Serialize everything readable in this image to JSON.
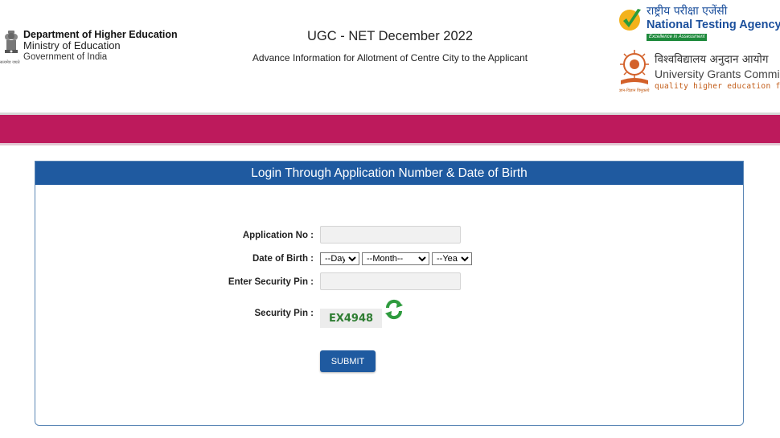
{
  "header": {
    "ministry": {
      "line1": "Department of Higher Education",
      "line2": "Ministry of Education",
      "line3": "Government of India",
      "emblem_caption": "सत्यमेव जयते"
    },
    "title": "UGC - NET December 2022",
    "subtitle": "Advance Information for Allotment of Centre City to the Applicant",
    "nta": {
      "hindi": "राष्ट्रीय परीक्षा एजेंसी",
      "english": "National Testing Agency",
      "tagline": "Excellence in Assessment"
    },
    "ugc": {
      "hindi": "विश्वविद्यालय अनुदान आयोग",
      "english": "University Grants Commission",
      "tagline": "quality higher education for all",
      "logo_caption": "ज्ञान-विज्ञान विमुक्तये"
    }
  },
  "colors": {
    "band": "#bd1a5c",
    "panel_header": "#1f5aa0",
    "captcha_text": "#2e7d32"
  },
  "login": {
    "heading": "Login Through Application Number & Date of Birth",
    "application_label": "Application No :",
    "application_value": "",
    "dob_label": "Date of Birth :",
    "day_selected": "--Day--",
    "month_selected": "--Month--",
    "year_selected": "--Year--",
    "security_input_label": "Enter Security Pin :",
    "security_input_value": "",
    "security_pin_label": "Security Pin :",
    "captcha_text": "EX4948",
    "refresh_icon": "refresh-icon",
    "submit_label": "SUBMIT"
  }
}
